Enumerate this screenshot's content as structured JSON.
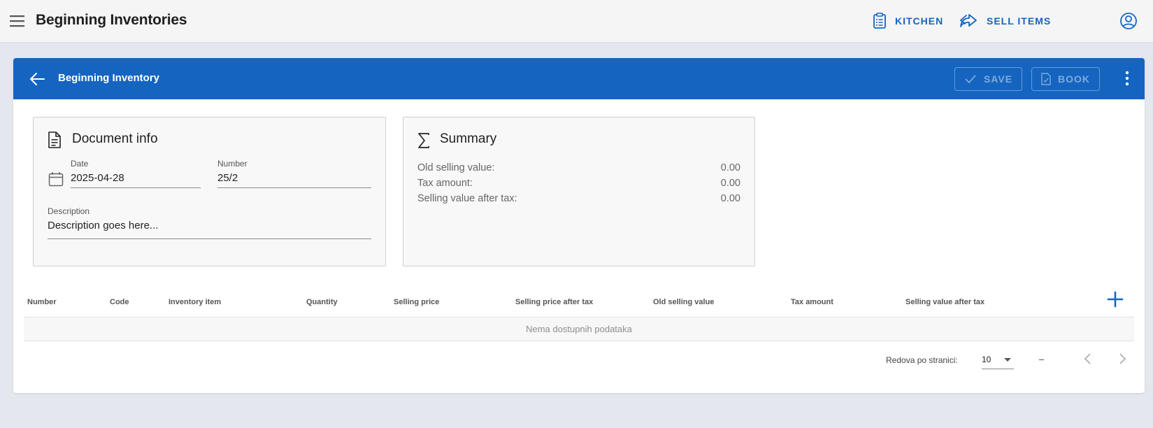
{
  "app": {
    "title": "Beginning Inventories",
    "actions": {
      "kitchen": "KITCHEN",
      "sell_items": "SELL ITEMS"
    }
  },
  "card": {
    "title": "Beginning Inventory",
    "buttons": {
      "save": "SAVE",
      "book": "BOOK"
    }
  },
  "document_info": {
    "title": "Document info",
    "date_label": "Date",
    "date_value": "2025-04-28",
    "number_label": "Number",
    "number_value": "25/2",
    "description_label": "Description",
    "description_value": "Description goes here..."
  },
  "summary": {
    "title": "Summary",
    "rows": [
      {
        "label": "Old selling value:",
        "value": "0.00"
      },
      {
        "label": "Tax amount:",
        "value": "0.00"
      },
      {
        "label": "Selling value after tax:",
        "value": "0.00"
      }
    ]
  },
  "table": {
    "columns": [
      "Number",
      "Code",
      "Inventory item",
      "Quantity",
      "Selling price",
      "Selling price after tax",
      "Old selling value",
      "Tax amount",
      "Selling value after tax"
    ],
    "empty_text": "Nema dostupnih podataka"
  },
  "pagination": {
    "rows_per_page_label": "Redova po stranici:",
    "rows_per_page_value": "10",
    "range": "–"
  },
  "icons": {
    "menu": "menu-icon",
    "kitchen": "clipboard-list-icon",
    "sell": "share-arrow-icon",
    "account": "account-circle-icon",
    "back": "arrow-left-icon",
    "save": "check-icon",
    "book": "document-check-icon",
    "more": "dots-vertical-icon",
    "doc": "document-icon",
    "summary": "sigma-icon",
    "calendar": "calendar-icon",
    "add": "plus-icon",
    "prev": "chevron-left-icon",
    "next": "chevron-right-icon"
  },
  "colors": {
    "primary": "#1565c0",
    "background": "#e4e7ee"
  }
}
